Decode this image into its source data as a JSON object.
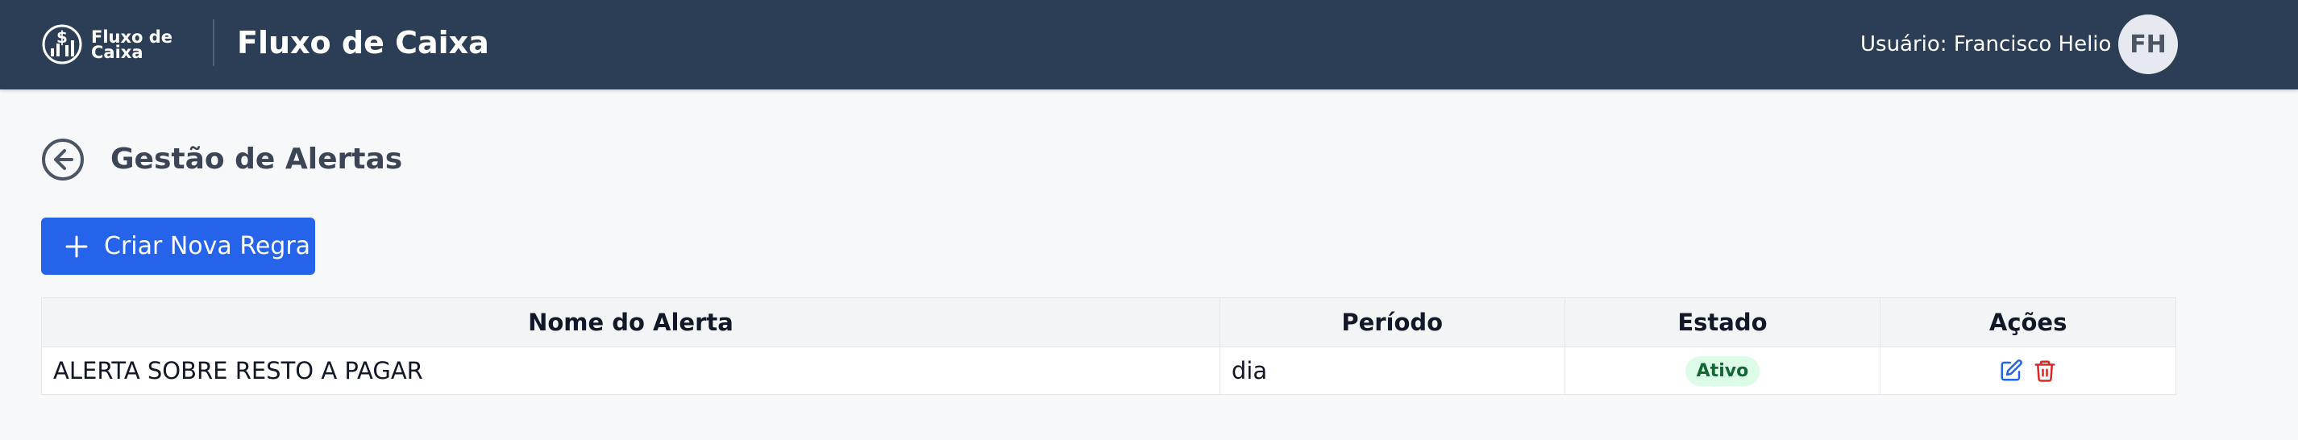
{
  "header": {
    "logo_line1": "Fluxo de",
    "logo_line2": "Caixa",
    "app_title": "Fluxo de Caixa",
    "user_label": "Usuário: Francisco Helio",
    "avatar_initials": "FH"
  },
  "page": {
    "title": "Gestão de Alertas",
    "create_button": "Criar Nova Regra"
  },
  "table": {
    "columns": [
      "Nome do Alerta",
      "Período",
      "Estado",
      "Ações"
    ],
    "rows": [
      {
        "name": "ALERTA SOBRE RESTO A PAGAR",
        "period": "dia",
        "status": "Ativo"
      }
    ]
  },
  "colors": {
    "header_bg": "#2c3e55",
    "primary": "#2563eb",
    "status_active_bg": "#dcfce7",
    "status_active_text": "#166534",
    "edit_icon": "#2563eb",
    "delete_icon": "#dc2626"
  },
  "icons": {
    "logo": "dollar-chart-logo-icon",
    "back": "arrow-left-circle-icon",
    "create": "plus-icon",
    "edit": "edit-icon",
    "delete": "trash-icon"
  }
}
